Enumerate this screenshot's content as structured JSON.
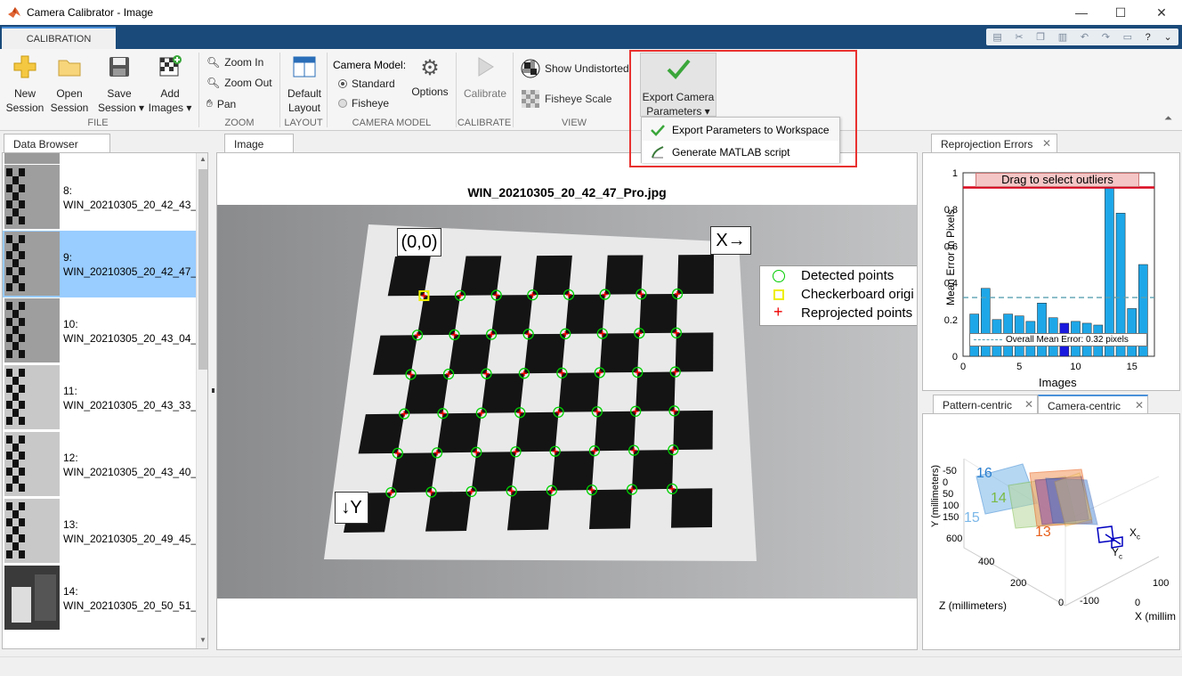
{
  "window": {
    "title": "Camera Calibrator - Image",
    "minimize": "—",
    "maximize": "☐",
    "close": "✕"
  },
  "tabs": {
    "calibration": "CALIBRATION"
  },
  "ribbon": {
    "file": {
      "new": "New\nSession",
      "open": "Open\nSession",
      "save": "Save\nSession ▾",
      "add": "Add\nImages ▾",
      "label": "FILE"
    },
    "zoom": {
      "in": "Zoom In",
      "out": "Zoom Out",
      "pan": "Pan",
      "label": "ZOOM"
    },
    "layout": {
      "default": "Default\nLayout",
      "label": "LAYOUT"
    },
    "camera_model": {
      "title": "Camera Model:",
      "standard": "Standard",
      "fisheye": "Fisheye",
      "options": "Options",
      "label": "CAMERA MODEL"
    },
    "calibrate": {
      "btn": "Calibrate",
      "label": "CALIBRATE"
    },
    "view": {
      "show_undistorted": "Show Undistorted",
      "fisheye_scale": "Fisheye Scale",
      "label": "VIEW"
    },
    "export": {
      "btn": "Export Camera\nParameters ▾"
    }
  },
  "export_menu": {
    "item1": "Export Parameters to Workspace",
    "item2": "Generate MATLAB script"
  },
  "data_browser": {
    "tab": "Data Browser",
    "items": [
      {
        "n": "8:",
        "name": "WIN_20210305_20_42_43_"
      },
      {
        "n": "9:",
        "name": "WIN_20210305_20_42_47_",
        "selected": true
      },
      {
        "n": "10:",
        "name": "WIN_20210305_20_43_04_"
      },
      {
        "n": "11:",
        "name": "WIN_20210305_20_43_33_"
      },
      {
        "n": "12:",
        "name": "WIN_20210305_20_43_40_"
      },
      {
        "n": "13:",
        "name": "WIN_20210305_20_49_45_"
      },
      {
        "n": "14:",
        "name": "WIN_20210305_20_50_51_"
      }
    ]
  },
  "image_panel": {
    "tab": "Image",
    "title": "WIN_20210305_20_42_47_Pro.jpg",
    "origin": "(0,0)",
    "xaxis": "X→",
    "yaxis": "↓Y",
    "legend": {
      "detected": "Detected points",
      "origin": "Checkerboard origi",
      "reprojected": "Reprojected points"
    }
  },
  "reprojection": {
    "tab": "Reprojection Errors",
    "drag_label": "Drag to select outliers",
    "mean_label": "Overall Mean Error: 0.32 pixels",
    "xlabel": "Images",
    "ylabel": "Mean Error in Pixels",
    "chart_data": {
      "type": "bar",
      "x": [
        1,
        2,
        3,
        4,
        5,
        6,
        7,
        8,
        9,
        10,
        11,
        12,
        13,
        14,
        15,
        16
      ],
      "values": [
        0.23,
        0.37,
        0.2,
        0.23,
        0.22,
        0.19,
        0.29,
        0.21,
        0.18,
        0.19,
        0.18,
        0.17,
        0.94,
        0.78,
        0.26,
        0.5
      ],
      "selected": 9,
      "threshold": 0.92,
      "mean": 0.32,
      "ylim": [
        0,
        1
      ],
      "xlim": [
        0,
        17
      ],
      "yticks": [
        "0",
        "0.2",
        "0.4",
        "0.6",
        "0.8",
        "1"
      ],
      "xticks": [
        "0",
        "5",
        "10",
        "15"
      ]
    }
  },
  "extrinsics": {
    "tab1": "Pattern-centric",
    "tab2": "Camera-centric",
    "ylabel": "Y (millimeters)",
    "zlabel": "Z (millimeters)",
    "xlabel": "X (millim",
    "yticks": [
      "-50",
      "0",
      "50",
      "100",
      "150"
    ],
    "zticks": [
      "600",
      "400",
      "200",
      "0"
    ],
    "xticks": [
      "-100",
      "0",
      "100"
    ],
    "labels": {
      "l16": "16",
      "l14": "14",
      "l15": "15",
      "l13": "13",
      "xc": "X",
      "xcsub": "c",
      "yc": "Y",
      "ycsub": "c"
    }
  },
  "colors": {
    "accent": "#1a4a7a",
    "selected": "#99ccff",
    "bar": "#1ea7e8",
    "bar_selected": "#1a1adf",
    "threshold": "#d9001b",
    "highlight_box": "#e8312f"
  }
}
